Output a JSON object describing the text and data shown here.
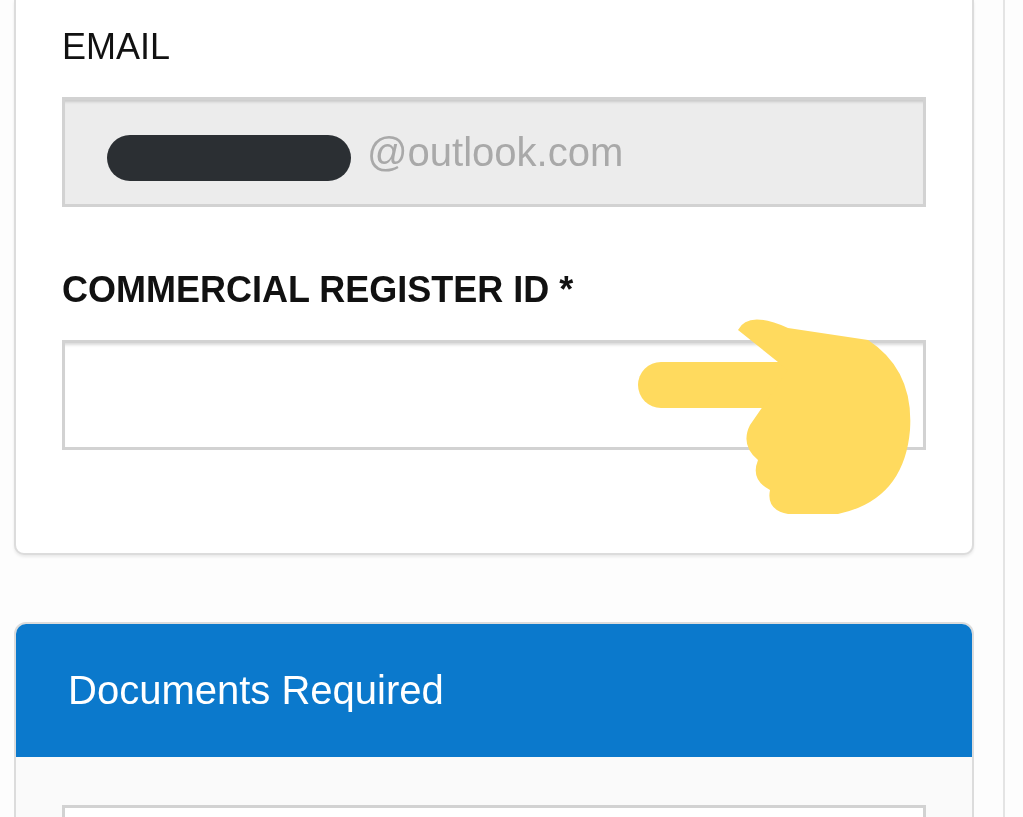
{
  "contact_card": {
    "fields": [
      {
        "label": "EMAIL",
        "value": "@outlook.com",
        "required": false,
        "disabled": true,
        "redacted": true
      },
      {
        "label": "COMMERCIAL REGISTER ID *",
        "required": true,
        "disabled": false,
        "redacted": false
      }
    ]
  },
  "documents_card": {
    "title": "Documents Required"
  }
}
